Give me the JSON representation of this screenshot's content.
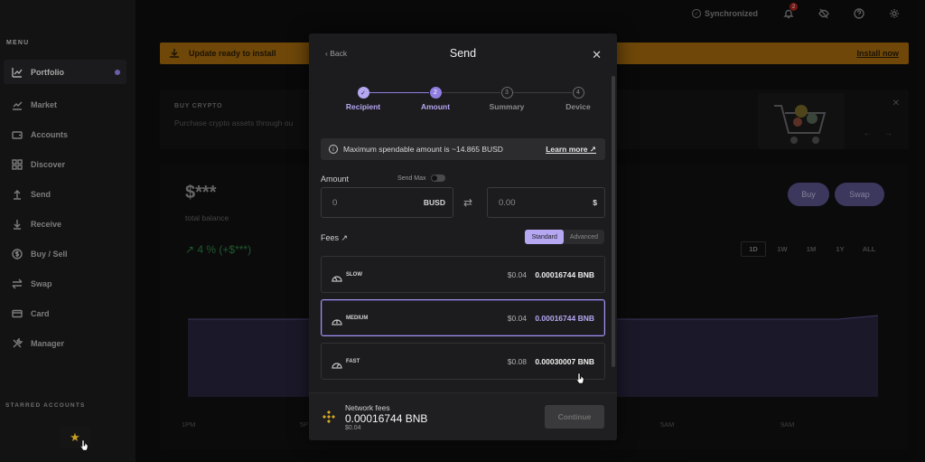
{
  "sidebar": {
    "menu_title": "MENU",
    "items": [
      {
        "label": "Portfolio",
        "icon": "chart-icon"
      },
      {
        "label": "Market",
        "icon": "trend-icon"
      },
      {
        "label": "Accounts",
        "icon": "wallet-icon"
      },
      {
        "label": "Discover",
        "icon": "grid-icon"
      },
      {
        "label": "Send",
        "icon": "arrow-up-icon"
      },
      {
        "label": "Receive",
        "icon": "arrow-down-icon"
      },
      {
        "label": "Buy / Sell",
        "icon": "dollar-icon"
      },
      {
        "label": "Swap",
        "icon": "swap-icon"
      },
      {
        "label": "Card",
        "icon": "card-icon"
      },
      {
        "label": "Manager",
        "icon": "tools-icon"
      }
    ],
    "starred_title": "STARRED ACCOUNTS",
    "star": "★"
  },
  "topbar": {
    "sync_label": "Synchronized",
    "notif_count": "2"
  },
  "banner": {
    "text": "Update ready to install",
    "action": "Install now"
  },
  "buy_crypto": {
    "title": "BUY CRYPTO",
    "text": "Purchase crypto assets through ou",
    "close": "✕",
    "nav": "← →"
  },
  "portfolio": {
    "balance": "$***",
    "balance_label": "total balance",
    "perf": "↗ 4 % (+$***)",
    "buy": "Buy",
    "swap": "Swap",
    "ranges": [
      "1D",
      "1W",
      "1M",
      "1Y",
      "ALL"
    ],
    "xlabels": [
      "1PM",
      "5P",
      "5AM",
      "9AM"
    ]
  },
  "modal": {
    "back": "‹ Back",
    "title": "Send",
    "close": "✕",
    "steps": [
      {
        "num": "✓",
        "label": "Recipient"
      },
      {
        "num": "2",
        "label": "Amount"
      },
      {
        "num": "3",
        "label": "Summary"
      },
      {
        "num": "4",
        "label": "Device"
      }
    ],
    "info_text": "Maximum spendable amount is ~14.865 BUSD",
    "info_icon": "i",
    "learn_more": "Learn more ↗",
    "amount_label": "Amount",
    "send_max": "Send Max",
    "amount_value": "0",
    "amount_unit": "BUSD",
    "swap_icon": "⇄",
    "fiat_value": "0.00",
    "fiat_unit": "$",
    "fees_label": "Fees ↗",
    "fee_modes": [
      "Standard",
      "Advanced"
    ],
    "fees": [
      {
        "name": "SLOW",
        "usd": "$0.04",
        "bnb": "0.00016744 BNB"
      },
      {
        "name": "MEDIUM",
        "usd": "$0.04",
        "bnb": "0.00016744 BNB"
      },
      {
        "name": "FAST",
        "usd": "$0.08",
        "bnb": "0.00030007 BNB"
      }
    ],
    "footer": {
      "label": "Network fees",
      "value": "0.00016744 BNB",
      "usd": "$0.04",
      "continue": "Continue"
    }
  }
}
